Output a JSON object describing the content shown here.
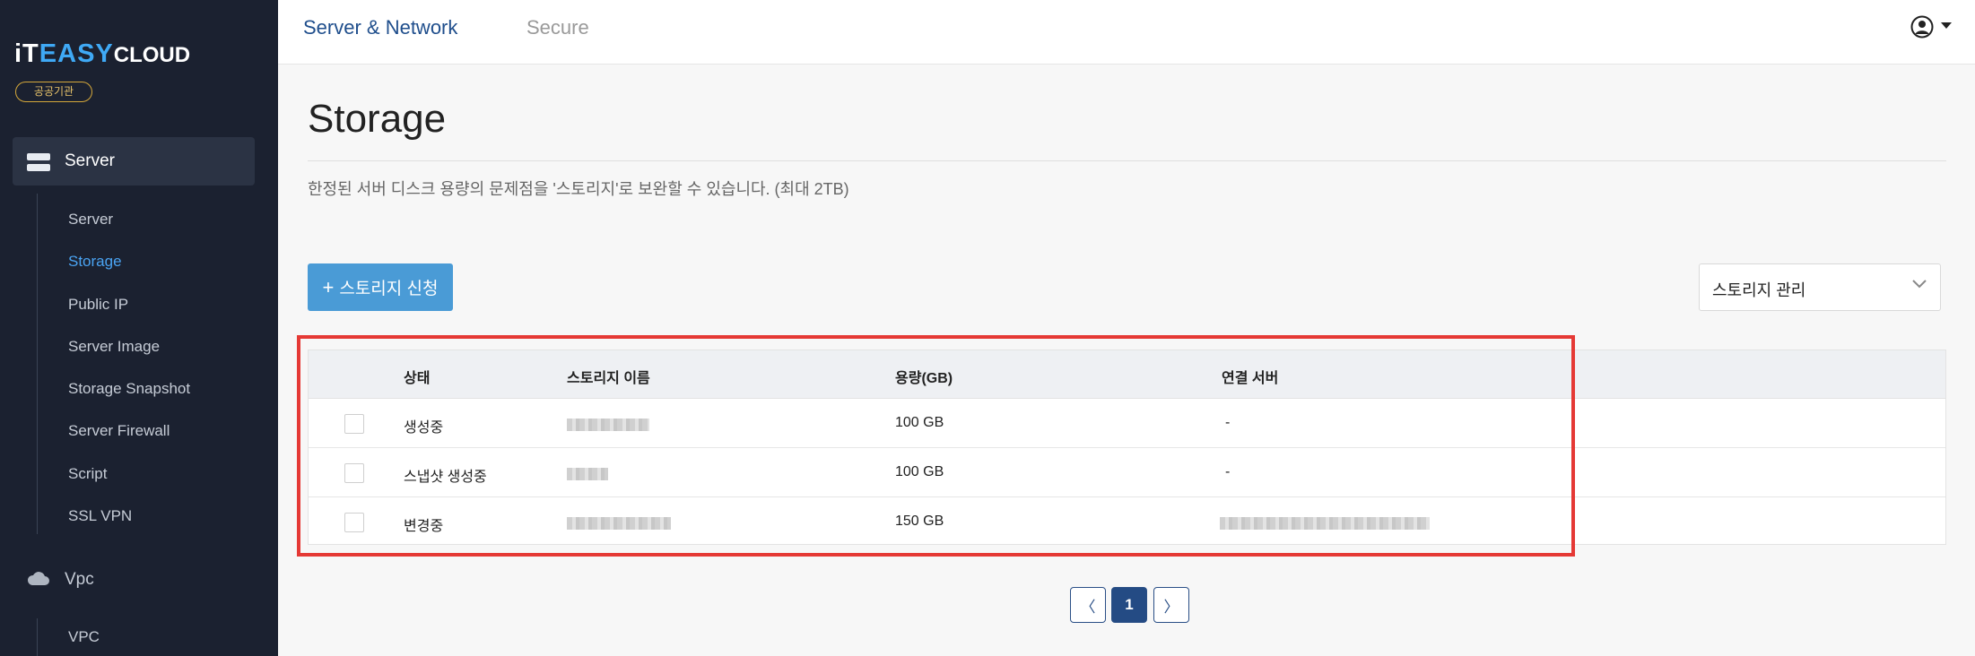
{
  "brand": {
    "logo_prefix": "iT",
    "logo_mid": "EASY",
    "logo_suffix": "CLOUD",
    "badge": "공공기관"
  },
  "sidebar": {
    "section_server": "Server",
    "items": [
      "Server",
      "Storage",
      "Public IP",
      "Server Image",
      "Storage Snapshot",
      "Server Firewall",
      "Script",
      "SSL VPN"
    ],
    "active_item": "Storage",
    "section_vpc": "Vpc",
    "vpc_items": [
      "VPC"
    ]
  },
  "header": {
    "tabs": [
      {
        "label": "Server & Network",
        "active": true
      },
      {
        "label": "Secure",
        "active": false
      }
    ]
  },
  "main": {
    "title": "Storage",
    "description": "한정된 서버 디스크 용량의 문제점을 '스토리지'로 보완할 수 있습니다. (최대 2TB)",
    "apply_button": "스토리지 신청",
    "manage_select": "스토리지 관리",
    "table": {
      "columns": [
        "상태",
        "스토리지 이름",
        "용량(GB)",
        "연결 서버"
      ],
      "rows": [
        {
          "status": "생성중",
          "capacity": "100 GB",
          "server": "-"
        },
        {
          "status": "스냅샷 생성중",
          "capacity": "100 GB",
          "server": "-"
        },
        {
          "status": "변경중",
          "capacity": "150 GB",
          "server": ""
        }
      ]
    },
    "pagination": {
      "prev": "〈",
      "current": "1",
      "next": "〉"
    }
  },
  "colors": {
    "sidebar_bg": "#1b2130",
    "accent": "#4a9bd6",
    "active_link": "#4aa3f2",
    "highlight": "#e53935",
    "nav_active": "#1f4e8c"
  }
}
